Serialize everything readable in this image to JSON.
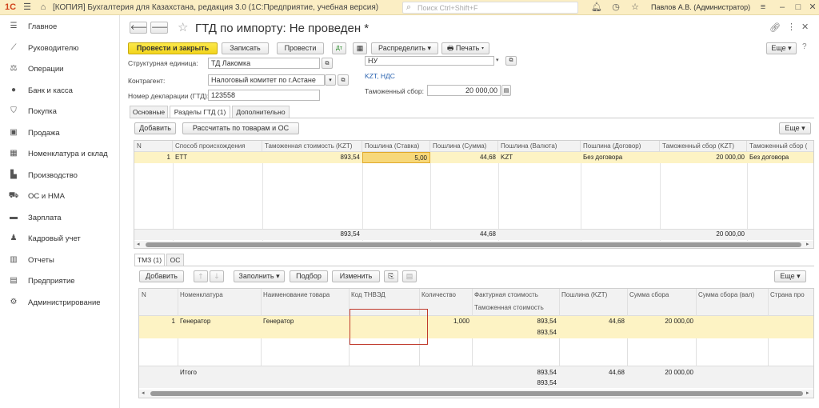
{
  "topbar": {
    "app_title": "[КОПИЯ] Бухгалтерия для Казахстана, редакция 3.0  (1С:Предприятие, учебная версия)",
    "search_placeholder": "Поиск Ctrl+Shift+F",
    "user": "Павлов А.В. (Администратор)",
    "logo": "1С"
  },
  "sidebar": {
    "items": [
      {
        "label": "Главное",
        "icon": "menu-icon"
      },
      {
        "label": "Руководителю",
        "icon": "chart-icon"
      },
      {
        "label": "Операции",
        "icon": "scales-icon"
      },
      {
        "label": "Банк и касса",
        "icon": "coin-icon"
      },
      {
        "label": "Покупка",
        "icon": "basket-icon"
      },
      {
        "label": "Продажа",
        "icon": "bag-icon"
      },
      {
        "label": "Номенклатура и склад",
        "icon": "grid-icon"
      },
      {
        "label": "Производство",
        "icon": "factory-icon"
      },
      {
        "label": "ОС и НМА",
        "icon": "truck-icon"
      },
      {
        "label": "Зарплата",
        "icon": "money-icon"
      },
      {
        "label": "Кадровый учет",
        "icon": "people-icon"
      },
      {
        "label": "Отчеты",
        "icon": "report-icon"
      },
      {
        "label": "Предприятие",
        "icon": "building-icon"
      },
      {
        "label": "Администрирование",
        "icon": "gear-icon"
      }
    ]
  },
  "doc": {
    "title": "ГТД по импорту: Не проведен *"
  },
  "toolbar": {
    "post_close": "Провести и закрыть",
    "save": "Записать",
    "post": "Провести",
    "distribute": "Распределить",
    "print": "Печать",
    "more": "Еще"
  },
  "fields": {
    "unit_label": "Структурная единица:",
    "unit_value": "ТД Лакомка",
    "counterparty_label": "Контрагент:",
    "counterparty_value": "Налоговый комитет по г.Астане",
    "decl_label": "Номер декларации (ГТД):",
    "decl_value": "123558",
    "tax_value": "НУ",
    "currency_link": "KZT, НДС",
    "fee_label": "Таможенный сбор:",
    "fee_value": "20 000,00"
  },
  "tabs": [
    "Основные",
    "Разделы ГТД (1)",
    "Дополнительно"
  ],
  "sections": {
    "add": "Добавить",
    "calc": "Рассчитать по товарам и ОС",
    "more": "Еще",
    "columns": [
      "N",
      "Способ происхождения",
      "Таможенная стоимость (KZT)",
      "Пошлина (Ставка)",
      "Пошлина (Сумма)",
      "Пошлина (Валюта)",
      "Пошлина (Договор)",
      "Таможенный сбор (KZT)",
      "Таможенный сбор ("
    ],
    "row": [
      "1",
      "ЕТТ",
      "893,54",
      "5,00",
      "44,68",
      "KZT",
      "Без договора",
      "20 000,00",
      "Без договора"
    ],
    "totals": {
      "customs": "893,54",
      "duty": "44,68",
      "fee": "20 000,00"
    }
  },
  "subtabs": [
    "ТМЗ (1)",
    "ОС"
  ],
  "goods": {
    "add": "Добавить",
    "fill": "Заполнить",
    "pick": "Подбор",
    "edit": "Изменить",
    "more": "Еще",
    "columns": [
      "N",
      "Номенклатура",
      "Наименование товара",
      "Код ТНВЭД",
      "Количество",
      "Фактурная стоимость",
      "Таможенная стоимость",
      "Пошлина (KZT)",
      "Сумма сбора",
      "Сумма сбора (вал)",
      "Страна про"
    ],
    "row": {
      "n": "1",
      "item": "Генератор",
      "name": "Генератор",
      "code": "",
      "qty": "1,000",
      "invoice": "893,54",
      "customs": "893,54",
      "duty": "44,68",
      "fee": "20 000,00"
    },
    "totals": {
      "label": "Итого",
      "invoice": "893,54",
      "customs": "893,54",
      "duty": "44,68",
      "fee": "20 000,00"
    }
  },
  "colors": {
    "accent_yellow": "#f3d51d",
    "row_highlight": "#fdf3c4",
    "selection_frame": "#c0392b",
    "link": "#2a63b0"
  }
}
